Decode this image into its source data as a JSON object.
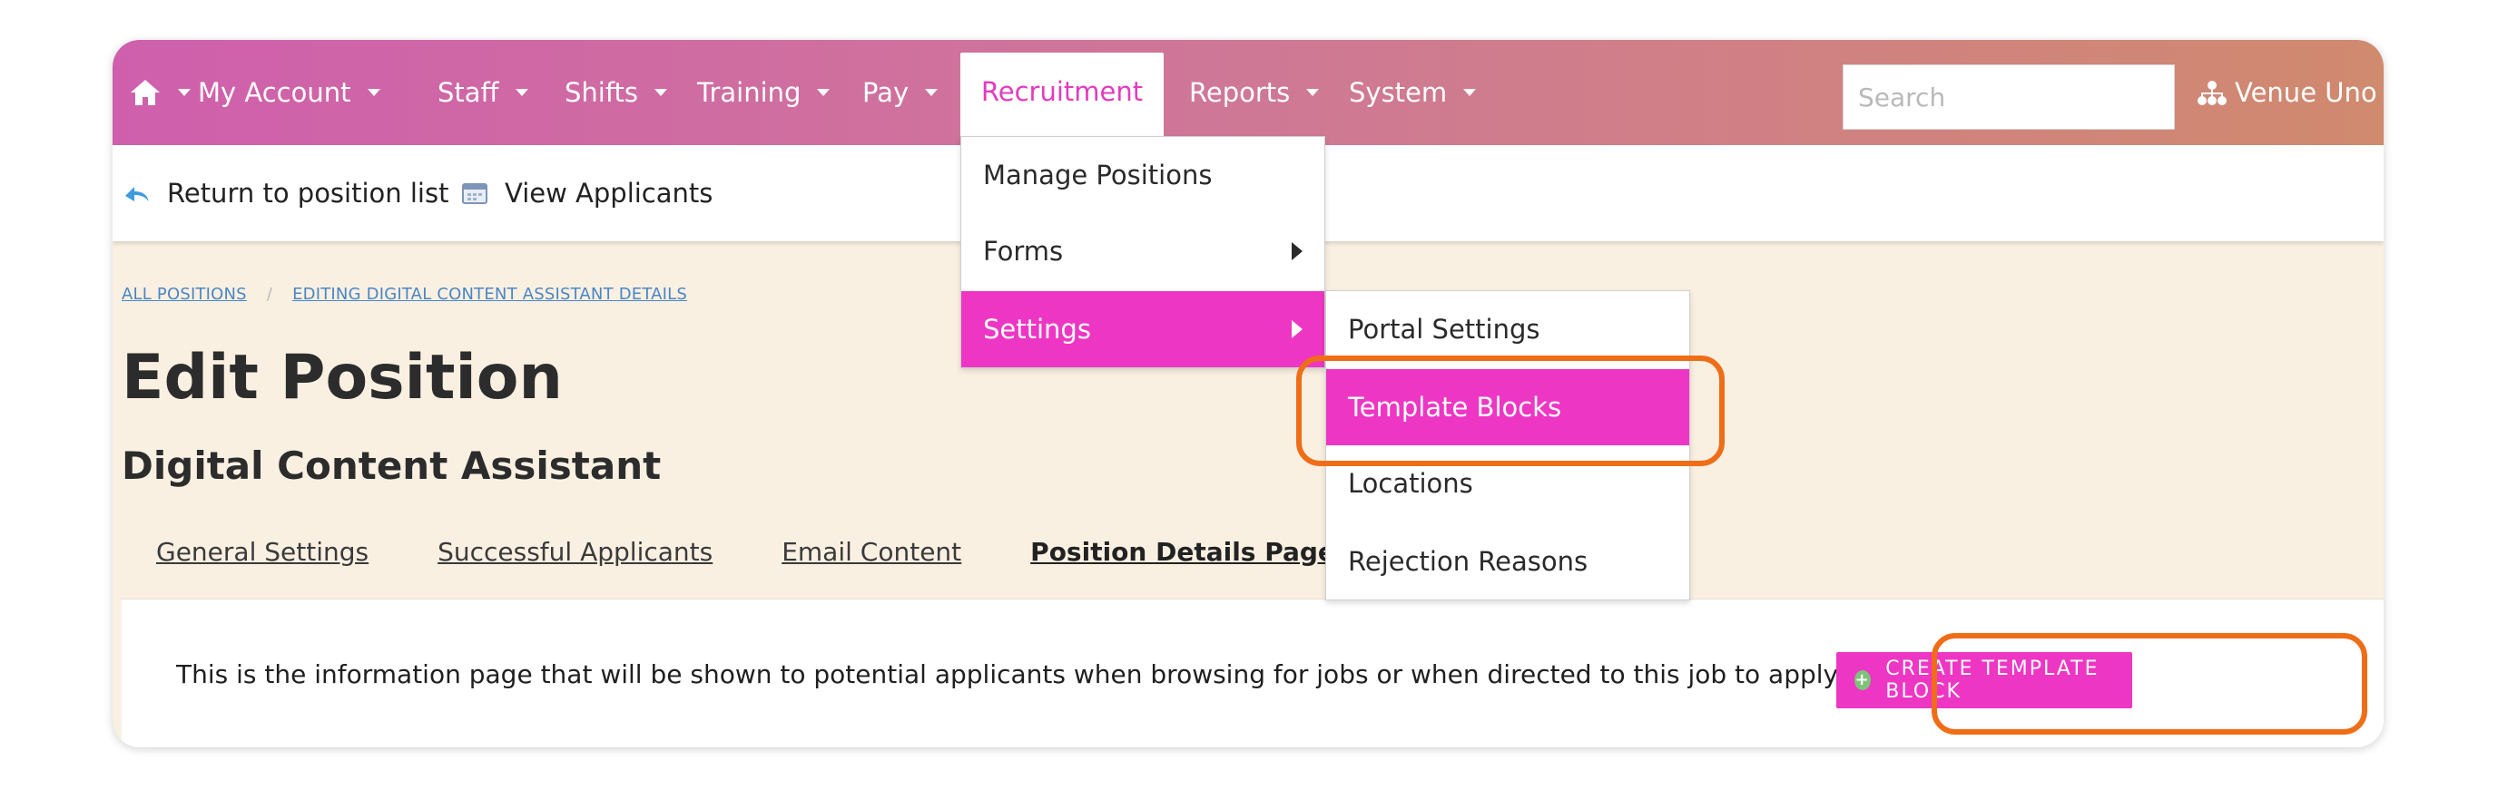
{
  "navbar": {
    "items": [
      {
        "label": "My Account"
      },
      {
        "label": "Staff"
      },
      {
        "label": "Shifts"
      },
      {
        "label": "Training"
      },
      {
        "label": "Pay"
      },
      {
        "label": "Recruitment"
      },
      {
        "label": "Reports"
      },
      {
        "label": "System"
      }
    ],
    "search_placeholder": "Search",
    "venue": "Venue Uno"
  },
  "toolbar": {
    "return_label": "Return to position list",
    "view_applicants_label": "View Applicants"
  },
  "breadcrumb": {
    "items": [
      "ALL POSITIONS",
      "EDITING DIGITAL CONTENT ASSISTANT DETAILS"
    ],
    "separator": "/"
  },
  "page": {
    "title": "Edit Position",
    "subtitle": "Digital Content Assistant"
  },
  "tabs": [
    {
      "label": "General Settings"
    },
    {
      "label": "Successful Applicants"
    },
    {
      "label": "Email Content"
    },
    {
      "label": "Position Details Page"
    }
  ],
  "panel": {
    "description": "This is the information page that will be shown to potential applicants when browsing for jobs or when directed to this job to apply.",
    "create_button": "CREATE TEMPLATE BLOCK"
  },
  "recruitment_menu": {
    "items": [
      {
        "label": "Manage Positions"
      },
      {
        "label": "Forms"
      },
      {
        "label": "Settings"
      }
    ]
  },
  "settings_menu": {
    "items": [
      {
        "label": "Portal Settings"
      },
      {
        "label": "Template Blocks"
      },
      {
        "label": "Locations"
      },
      {
        "label": "Rejection Reasons"
      }
    ]
  },
  "colors": {
    "accent": "#ee36c4",
    "callout": "#f06d17",
    "background": "#faf0e2"
  }
}
